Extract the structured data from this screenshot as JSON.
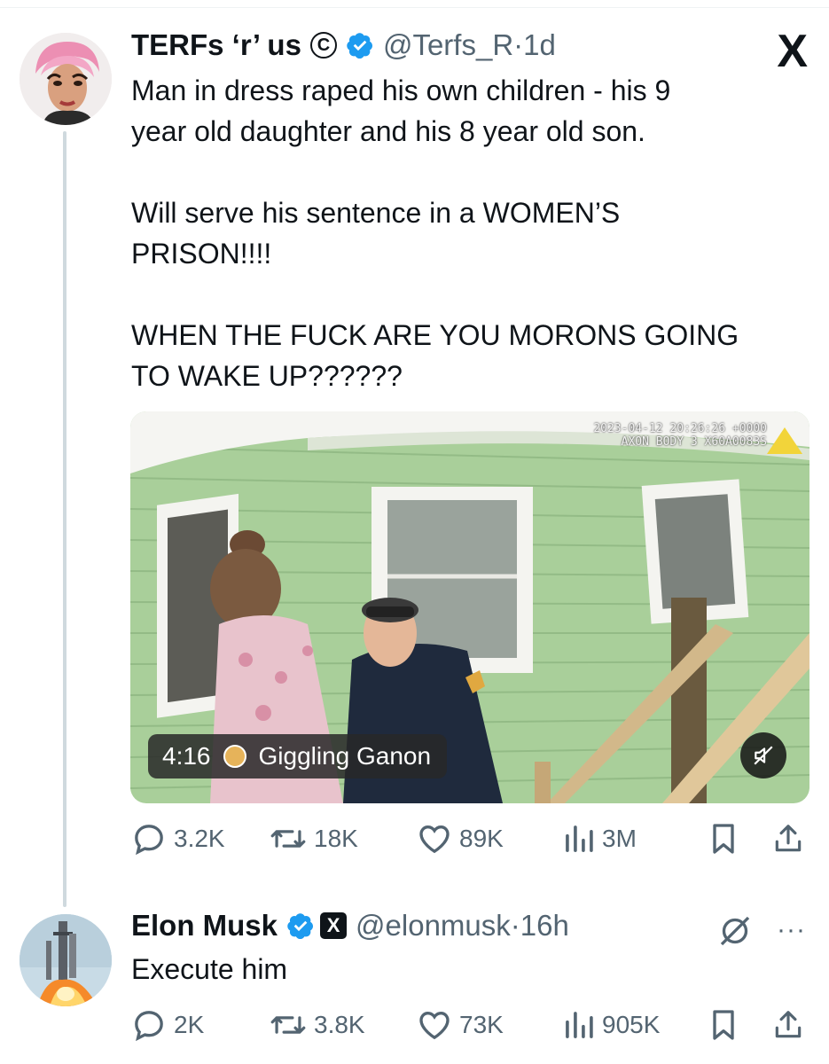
{
  "tweet": {
    "display_name": "TERFs ‘r’ us",
    "copyright_mark": "C",
    "handle": "@Terfs_R",
    "separator": "·",
    "time": "1d",
    "text_lines": [
      "Man in dress raped his own children - his 9",
      "year old daughter and his 8 year old son.",
      "",
      "Will serve his sentence in a WOMEN’S",
      "PRISON!!!!",
      "",
      "WHEN THE FUCK ARE YOU MORONS GOING",
      "TO WAKE UP??????"
    ],
    "video": {
      "duration": "4:16",
      "source": "Giggling Ganon",
      "stamp_line1": "2023-04-12 20:26:26 +0000",
      "stamp_line2": "AXON BODY 3  X60A0083S"
    },
    "stats": {
      "replies": "3.2K",
      "reposts": "18K",
      "likes": "89K",
      "views": "3M"
    }
  },
  "app": {
    "logo_icon": "x-logo-icon",
    "logo_text": "X"
  },
  "reply": {
    "display_name": "Elon Musk",
    "badge_letter": "X",
    "handle": "@elonmusk",
    "separator": "·",
    "time": "16h",
    "text": "Execute him",
    "more": "···",
    "stats": {
      "replies": "2K",
      "reposts": "3.8K",
      "likes": "73K",
      "views": "905K"
    }
  },
  "colors": {
    "verified": "#1d9bf0",
    "secondary_text": "#536471",
    "thread_line": "#cfd9de"
  }
}
